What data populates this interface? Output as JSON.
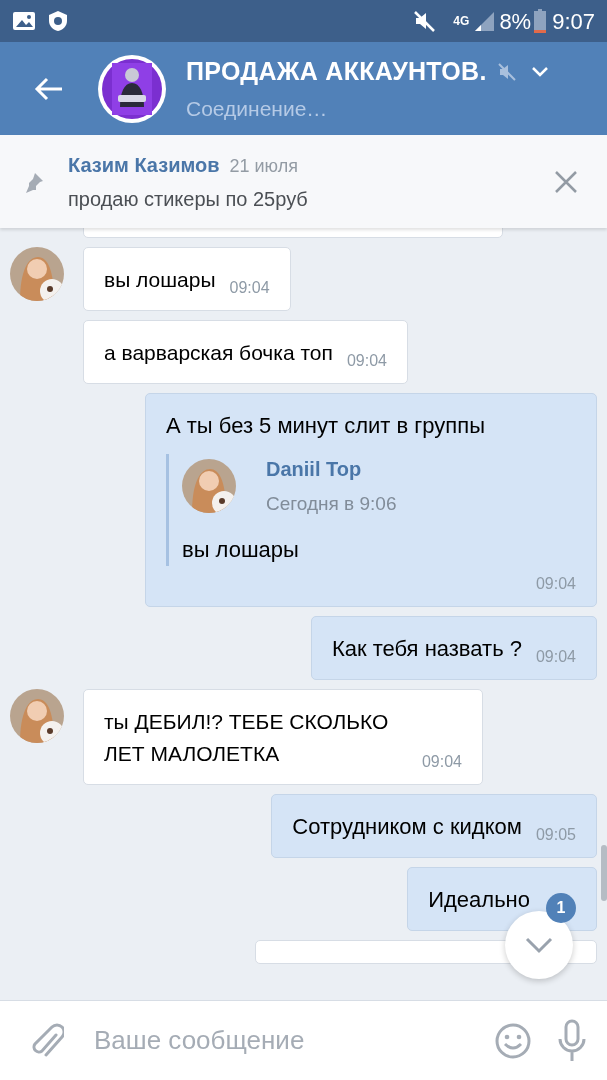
{
  "status_bar": {
    "battery": "8%",
    "network": "4G",
    "time": "9:07"
  },
  "header": {
    "title": "ПРОДАЖА АККАУНТОВ.",
    "subtitle": "Соединение…",
    "muted": true
  },
  "pinned": {
    "author": "Казим Казимов",
    "date": "21 июля",
    "text": "продаю стикеры по 25руб"
  },
  "messages": [
    {
      "kind": "fragment_in"
    },
    {
      "kind": "incoming",
      "avatar": true,
      "text": "вы лошары",
      "time": "09:04"
    },
    {
      "kind": "incoming",
      "avatar": false,
      "text": "а варварская бочка топ",
      "time": "09:04"
    },
    {
      "kind": "outgoing",
      "text": "А ты без 5 минут слит в группы",
      "quote": {
        "author": "Daniil Top",
        "date": "Сегодня в 9:06",
        "text": "вы лошары"
      },
      "time": "09:04"
    },
    {
      "kind": "outgoing",
      "text": "Как тебя назвать ?",
      "time": "09:04"
    },
    {
      "kind": "incoming",
      "avatar": true,
      "text": "ты ДЕБИЛ!? ТЕБЕ СКОЛЬКО ЛЕТ МАЛОЛЕТКА",
      "time": "09:04"
    },
    {
      "kind": "outgoing",
      "text": "Сотрудником с кидком",
      "time": "09:05"
    },
    {
      "kind": "outgoing",
      "text": "Идеально"
    },
    {
      "kind": "fragment_out"
    }
  ],
  "scroll_button": {
    "badge": "1"
  },
  "composer": {
    "placeholder": "Ваше сообщение"
  }
}
